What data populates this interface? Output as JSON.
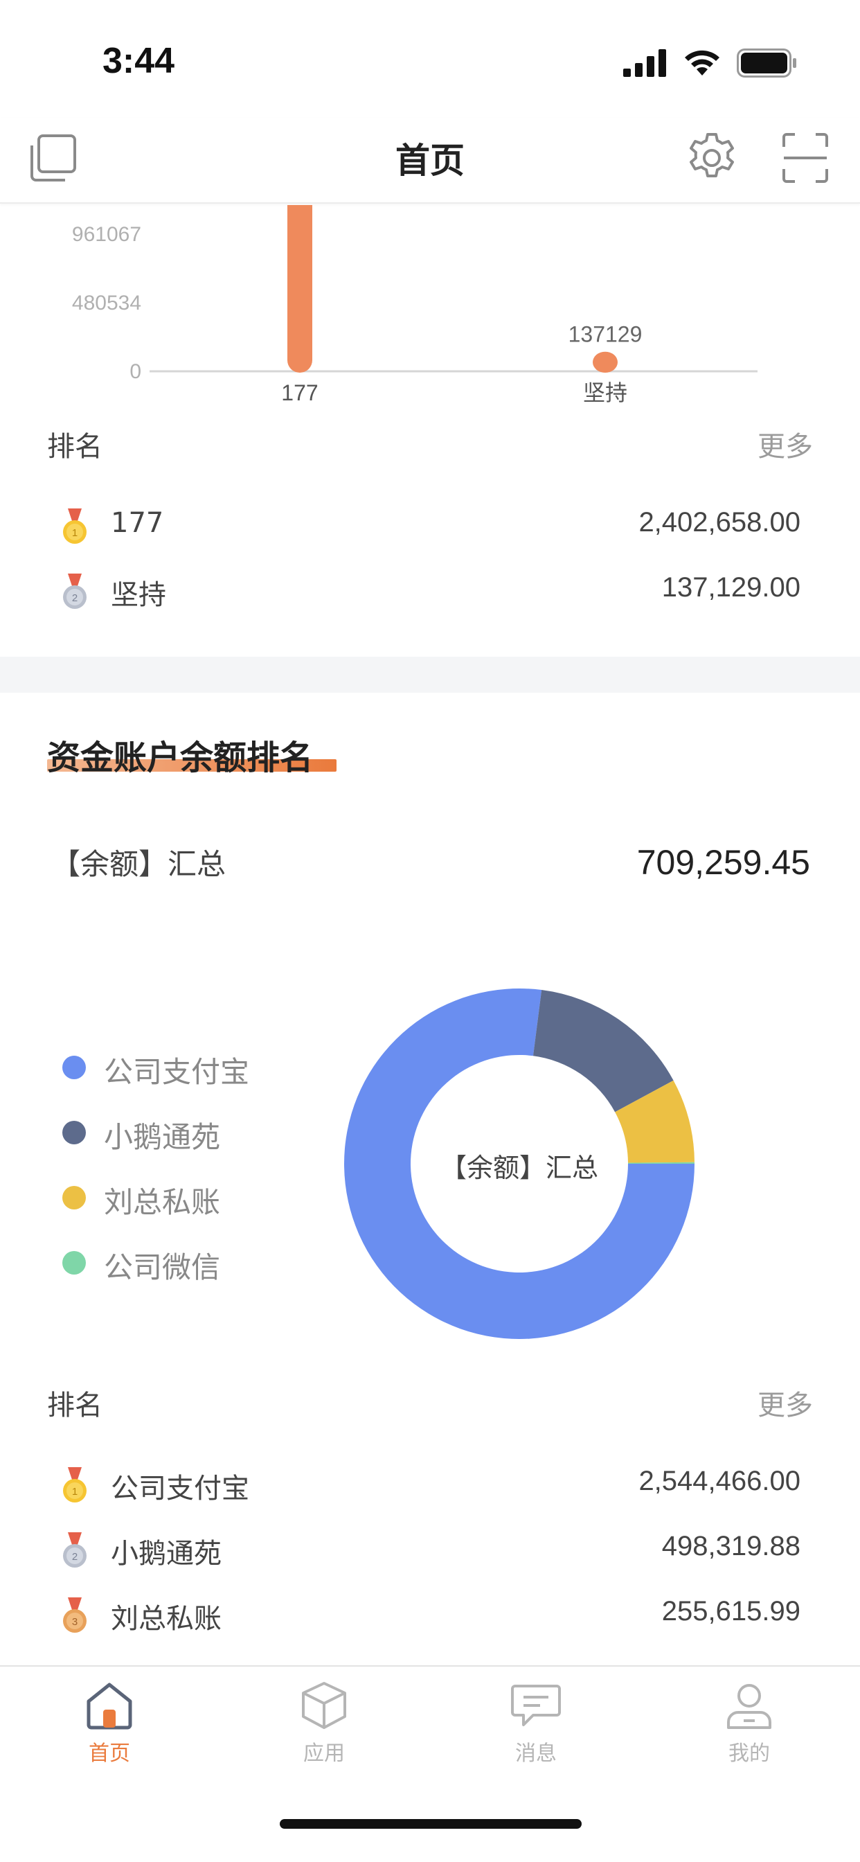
{
  "status_bar": {
    "time": "3:44"
  },
  "header": {
    "title": "首页"
  },
  "bar_chart": {
    "chart_data": {
      "type": "bar",
      "categories": [
        "177",
        "坚持"
      ],
      "values": [
        2402658,
        137129
      ],
      "data_labels": [
        "",
        "137129"
      ],
      "y_ticks": [
        "0",
        "480534",
        "961067"
      ],
      "colors": [
        "#ef8a5c"
      ]
    }
  },
  "ranking1": {
    "label": "排名",
    "more": "更多",
    "rows": [
      {
        "name": "177",
        "value": "2,402,658.00",
        "medal": "gold"
      },
      {
        "name": "坚持",
        "value": "137,129.00",
        "medal": "silver"
      }
    ]
  },
  "fund_section": {
    "title": "资金账户余额排名",
    "summary_label": "【余额】汇总",
    "summary_value": "709,259.45",
    "donut_center": "【余额】汇总",
    "legend": [
      {
        "label": "公司支付宝",
        "color": "#6a8ef0"
      },
      {
        "label": "小鹅通苑",
        "color": "#5d6b8c"
      },
      {
        "label": "刘总私账",
        "color": "#ecc044"
      },
      {
        "label": "公司微信",
        "color": "#7fd6a8"
      }
    ],
    "chart_data": {
      "type": "pie",
      "categories": [
        "公司支付宝",
        "小鹅通苑",
        "刘总私账",
        "公司微信"
      ],
      "values": [
        2544466.0,
        498319.88,
        255615.99,
        4800
      ],
      "colors": [
        "#6a8ef0",
        "#5d6b8c",
        "#ecc044",
        "#7fd6a8"
      ]
    }
  },
  "ranking2": {
    "label": "排名",
    "more": "更多",
    "rows": [
      {
        "name": "公司支付宝",
        "value": "2,544,466.00",
        "medal": "gold"
      },
      {
        "name": "小鹅通苑",
        "value": "498,319.88",
        "medal": "silver"
      },
      {
        "name": "刘总私账",
        "value": "255,615.99",
        "medal": "bronze"
      }
    ]
  },
  "tab_bar": {
    "tabs": [
      {
        "label": "首页",
        "icon": "home-icon",
        "active": true
      },
      {
        "label": "应用",
        "icon": "cube-icon",
        "active": false
      },
      {
        "label": "消息",
        "icon": "message-icon",
        "active": false
      },
      {
        "label": "我的",
        "icon": "user-icon",
        "active": false
      }
    ]
  },
  "colors": {
    "accent": "#ea7b3d",
    "inactive": "#b5b5b5"
  }
}
